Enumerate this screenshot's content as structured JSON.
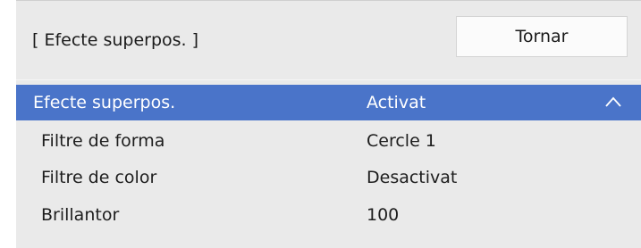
{
  "header": {
    "title": "[ Efecte superpos. ]",
    "back_label": "Tornar"
  },
  "menu": {
    "items": [
      {
        "label": "Efecte superpos.",
        "value": "Activat",
        "selected": true,
        "icon": "chevron-up-icon"
      },
      {
        "label": "Filtre de forma",
        "value": "Cercle 1"
      },
      {
        "label": "Filtre de color",
        "value": "Desactivat"
      },
      {
        "label": "Brillantor",
        "value": "100"
      }
    ]
  },
  "colors": {
    "selection": "#4a74c9",
    "panel_background": "#eaeaea",
    "text": "#1d1d1d"
  }
}
